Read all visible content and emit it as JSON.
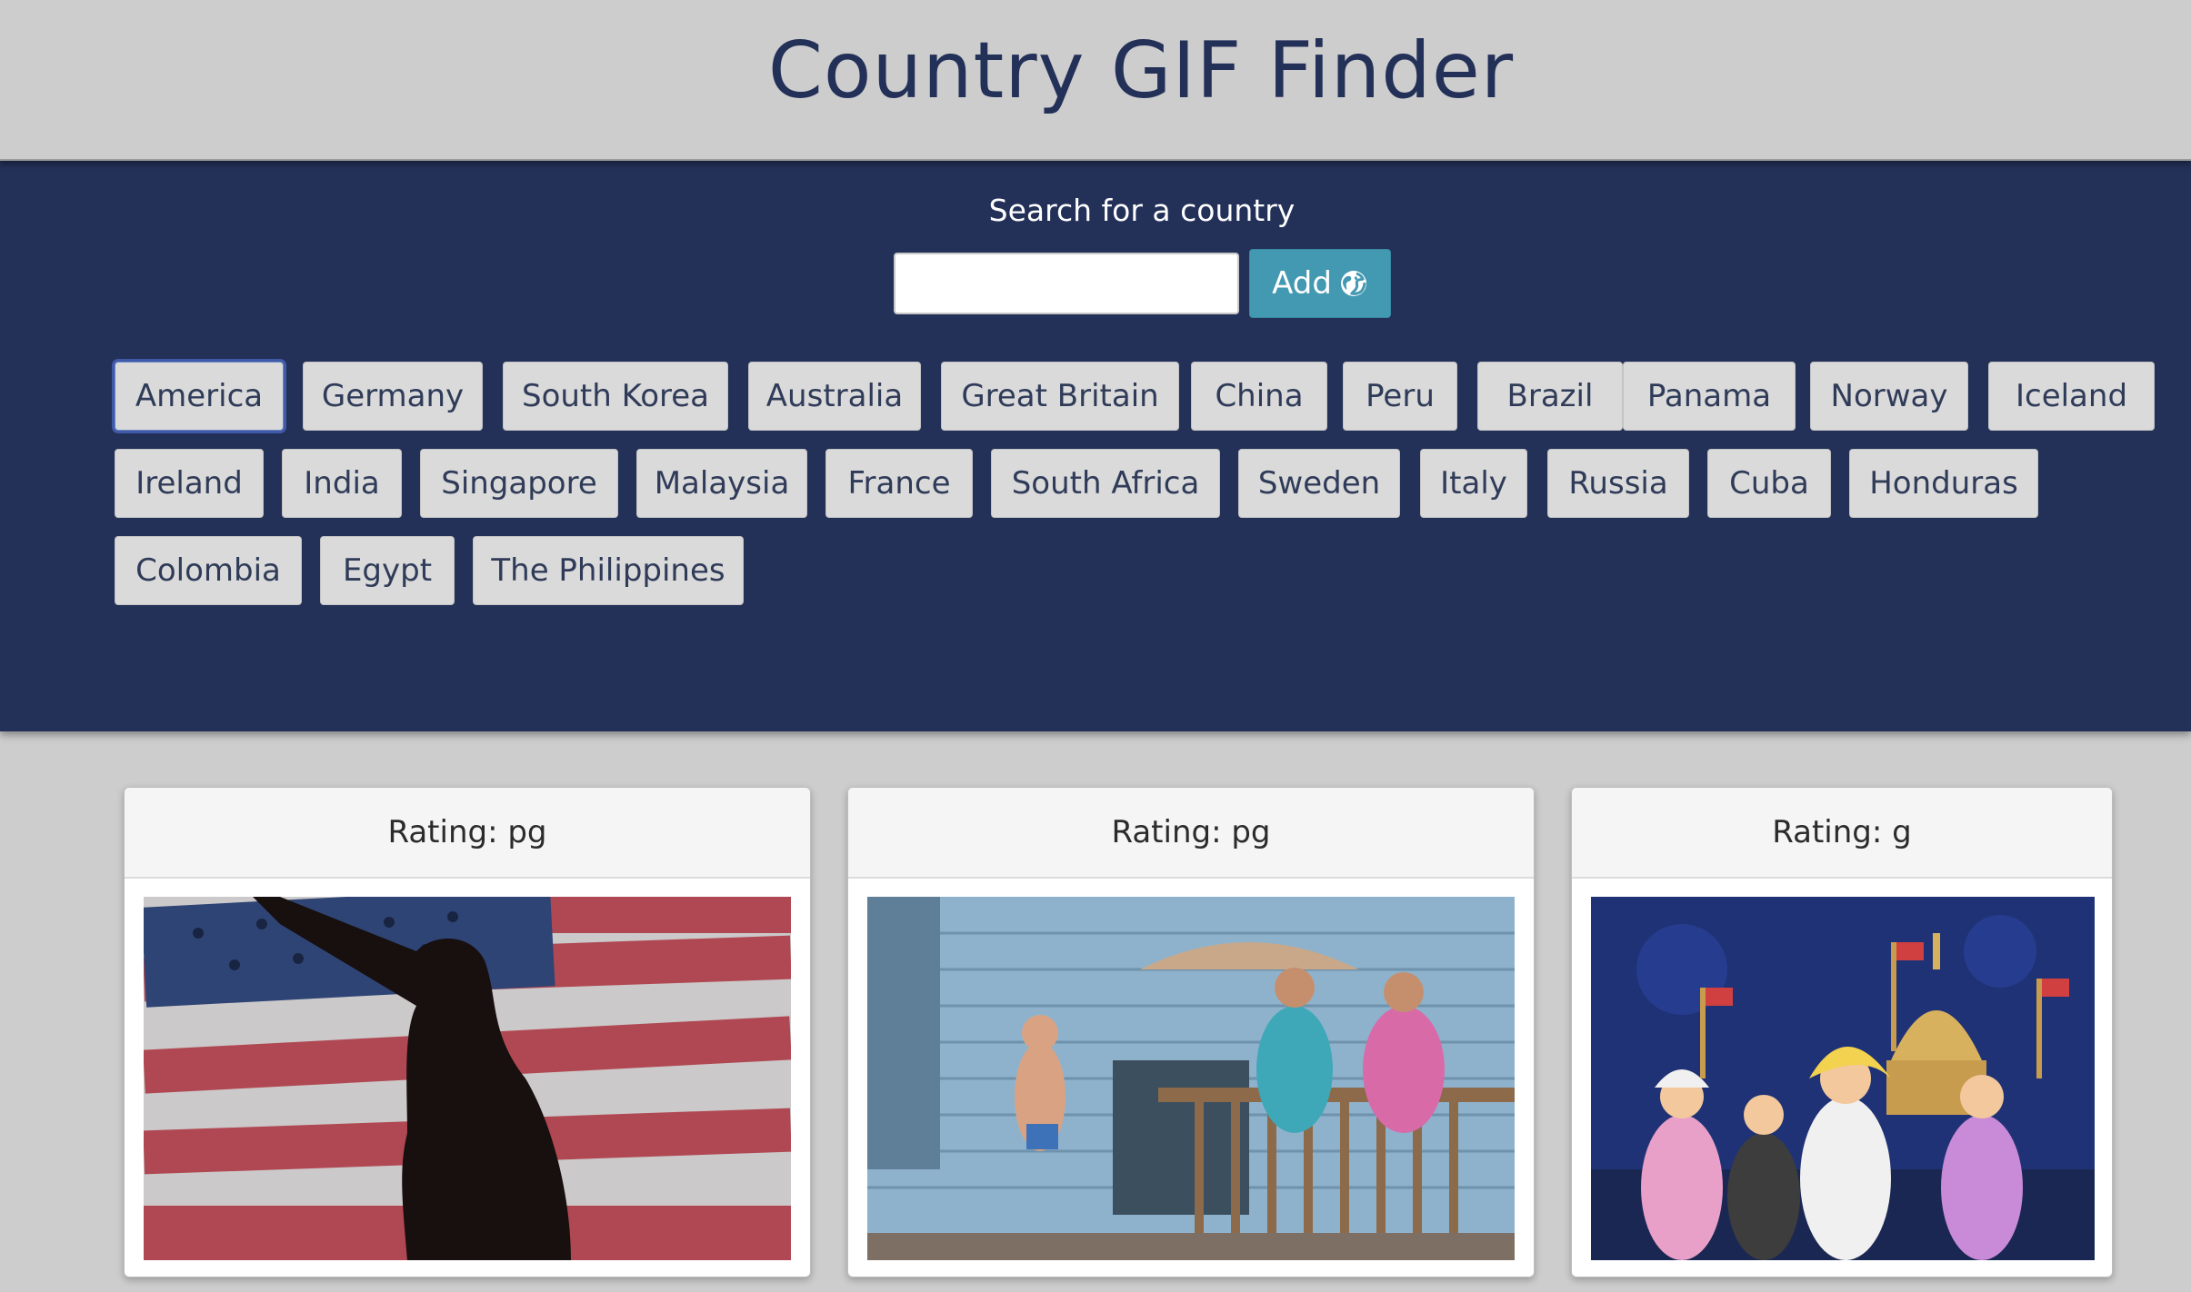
{
  "header": {
    "title": "Country GIF Finder"
  },
  "search": {
    "label": "Search for a country",
    "value": "",
    "placeholder": "",
    "add_label": "Add",
    "add_icon": "globe-icon"
  },
  "countries": [
    "America",
    "Germany",
    "South Korea",
    "Australia",
    "Great Britain",
    "China",
    "Peru",
    "Brazil",
    "Panama",
    "Norway",
    "Iceland",
    "Ireland",
    "India",
    "Singapore",
    "Malaysia",
    "France",
    "South Africa",
    "Sweden",
    "Italy",
    "Russia",
    "Cuba",
    "Honduras",
    "Colombia",
    "Egypt",
    "The Philippines"
  ],
  "active_country": "America",
  "results": [
    {
      "rating": "Rating: pg",
      "image": "flag-silhouette-gif"
    },
    {
      "rating": "Rating: pg",
      "image": "porch-party-gif"
    },
    {
      "rating": "Rating: g",
      "image": "cartoon-capitol-gif"
    }
  ],
  "colors": {
    "page_bg": "#cdcdcd",
    "panel_bg": "#233058",
    "title": "#233058",
    "add_button": "#4399b1",
    "country_button": "#dadada"
  }
}
